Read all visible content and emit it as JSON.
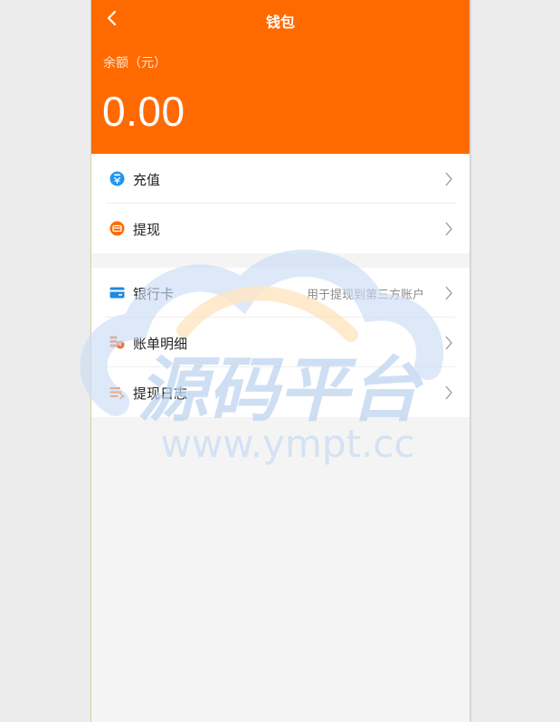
{
  "header": {
    "title": "钱包",
    "balance_label": "余额（元）",
    "balance_value": "0.00",
    "color": "#ff6a00"
  },
  "group1": [
    {
      "label": "充值",
      "icon": "recharge-icon",
      "icon_color": "#2196f3"
    },
    {
      "label": "提现",
      "icon": "withdraw-icon",
      "icon_color": "#ff6a00"
    }
  ],
  "group2": [
    {
      "label": "银行卡",
      "hint": "用于提现到第三方账户",
      "icon": "bank-card-icon",
      "icon_color": "#1e88e5"
    },
    {
      "label": "账单明细",
      "icon": "bill-details-icon",
      "icon_color": "#e8703a"
    },
    {
      "label": "提现日志",
      "icon": "withdraw-log-icon",
      "icon_color": "#ff6a00"
    }
  ],
  "watermark": {
    "title": "源码平台",
    "url": "www.ympt.cc"
  }
}
